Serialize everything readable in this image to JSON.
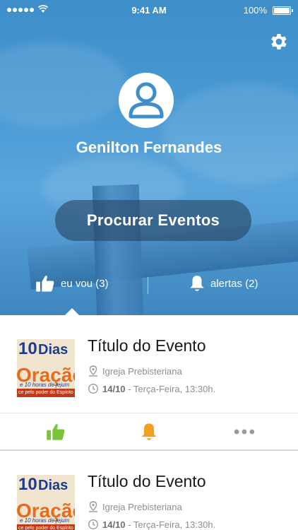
{
  "status_bar": {
    "time": "9:41 AM",
    "battery": "100%"
  },
  "profile": {
    "name": "Genilton Fernandes"
  },
  "search_button": {
    "label": "Procurar Eventos"
  },
  "stats": {
    "going": "eu vou (3)",
    "alerts": "alertas (2)"
  },
  "events": [
    {
      "title": "Título do Evento",
      "place": "Igreja Prebisteriana",
      "date_bold": "14/10",
      "date_rest": " - Terça-Feira, 13:30h.",
      "thumb": {
        "num": "10",
        "word": "Dias",
        "big": "Oração",
        "line": "e 10 horas de jejum",
        "foot": "ce pelo poder do Espírito"
      }
    },
    {
      "title": "Título do Evento",
      "place": "Igreja Prebisteriana",
      "date_bold": "14/10",
      "date_rest": " - Terça-Feira, 13:30h.",
      "thumb": {
        "num": "10",
        "word": "Dias",
        "big": "Oração",
        "line": "e 10 horas de jejum",
        "foot": "ce pelo poder do Espírito"
      }
    }
  ],
  "colors": {
    "like": "#7cc33c",
    "alert": "#f2a01e",
    "more": "#9a9a9a",
    "hero": "#4a9ad4"
  },
  "icons": [
    "gear-icon",
    "user-icon",
    "thumbs-up-icon",
    "bell-icon",
    "map-pin-icon",
    "clock-icon",
    "more-icon"
  ]
}
